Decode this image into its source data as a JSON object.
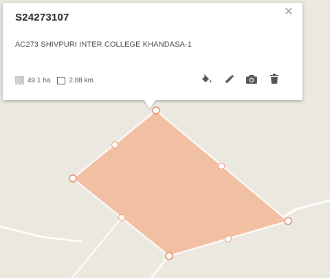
{
  "popup": {
    "title": "S24273107",
    "name": "AC273 SHIVPURI INTER COLLEGE KHANDASA-1",
    "area": "49.1 ha",
    "perimeter": "2.88 km",
    "close_icon": "close-icon",
    "actions": [
      {
        "name": "fill-color-icon"
      },
      {
        "name": "edit-pencil-icon"
      },
      {
        "name": "camera-icon"
      },
      {
        "name": "delete-trash-icon"
      }
    ]
  },
  "colors": {
    "polygon_fill": "#f2b897",
    "polygon_stroke": "#ffffff",
    "vertex_fill": "#ffffff",
    "vertex_stroke": "#e28a6a",
    "map_background": "#ebe8e0",
    "road": "#ffffff"
  }
}
